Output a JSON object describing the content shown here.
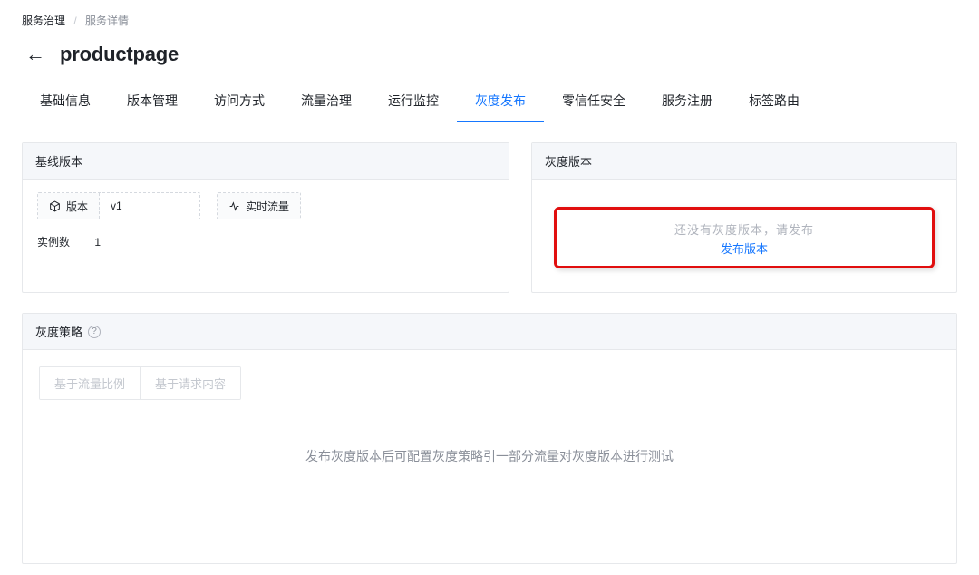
{
  "breadcrumb": {
    "root": "服务治理",
    "current": "服务详情"
  },
  "page": {
    "title": "productpage"
  },
  "tabs": [
    {
      "label": "基础信息",
      "active": false
    },
    {
      "label": "版本管理",
      "active": false
    },
    {
      "label": "访问方式",
      "active": false
    },
    {
      "label": "流量治理",
      "active": false
    },
    {
      "label": "运行监控",
      "active": false
    },
    {
      "label": "灰度发布",
      "active": true
    },
    {
      "label": "零信任安全",
      "active": false
    },
    {
      "label": "服务注册",
      "active": false
    },
    {
      "label": "标签路由",
      "active": false
    }
  ],
  "baseline": {
    "panel_title": "基线版本",
    "version_label": "版本",
    "version_value": "v1",
    "realtime_label": "实时流量",
    "instances_label": "实例数",
    "instances_value": "1"
  },
  "gray": {
    "panel_title": "灰度版本",
    "empty_hint": "还没有灰度版本，请发布",
    "publish_link": "发布版本"
  },
  "strategy": {
    "panel_title": "灰度策略",
    "option_traffic_ratio": "基于流量比例",
    "option_request_content": "基于请求内容",
    "empty_text": "发布灰度版本后可配置灰度策略引一部分流量对灰度版本进行测试"
  }
}
